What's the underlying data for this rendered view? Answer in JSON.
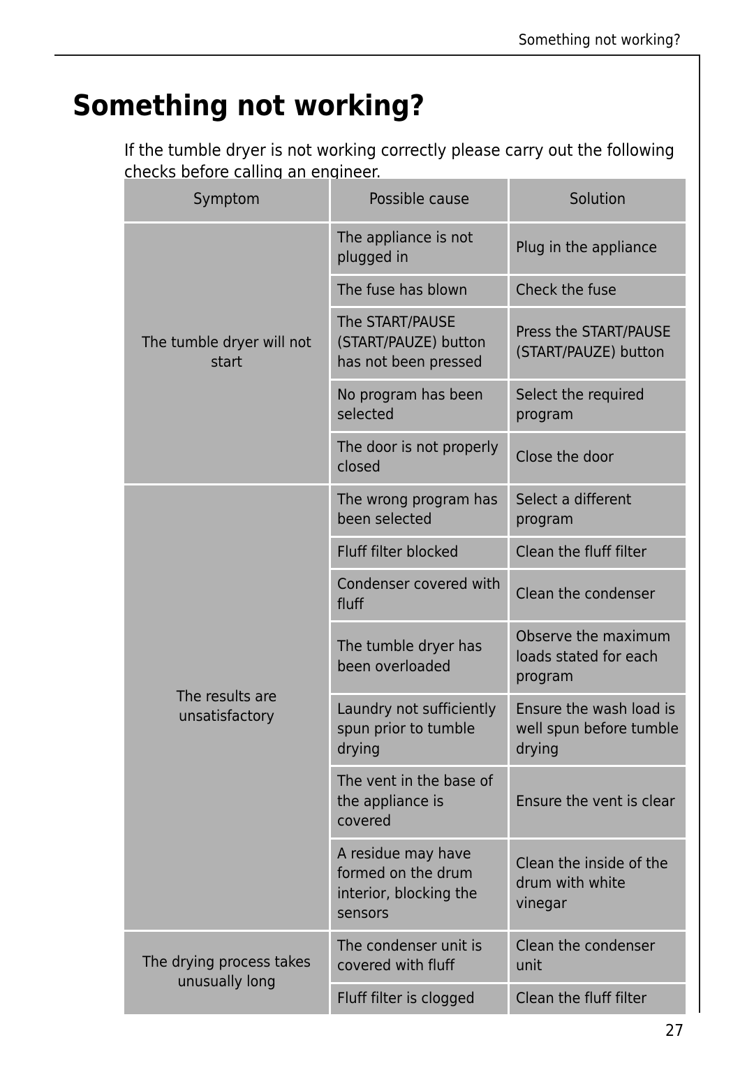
{
  "header": {
    "running_title": "Something not working?"
  },
  "title": "Something not working?",
  "intro": "If the tumble dryer is not working correctly please carry out the following checks before calling an engineer.",
  "table": {
    "columns": [
      "Symptom",
      "Possible cause",
      "Solution"
    ],
    "groups": [
      {
        "symptom": "The tumble dryer will not start",
        "rows": [
          {
            "cause": "The appliance is not plugged in",
            "solution": "Plug in the appliance"
          },
          {
            "cause": "The fuse has blown",
            "solution": "Check the fuse"
          },
          {
            "cause": "The START/PAUSE (START/PAUZE) button has not been pressed",
            "solution": "Press the START/PAUSE (START/PAUZE) button"
          },
          {
            "cause": "No program has been selected",
            "solution": "Select the required program"
          },
          {
            "cause": "The door is not properly closed",
            "solution": "Close the door"
          }
        ]
      },
      {
        "symptom": "The results are unsatisfactory",
        "rows": [
          {
            "cause": "The wrong program has been selected",
            "solution": "Select a different program"
          },
          {
            "cause": "Fluff filter blocked",
            "solution": "Clean the fluff filter"
          },
          {
            "cause": "Condenser covered with fluff",
            "solution": "Clean the condenser"
          },
          {
            "cause": "The tumble dryer has been overloaded",
            "solution": "Observe the maximum loads stated for each program"
          },
          {
            "cause": "Laundry not sufficiently spun prior to tumble drying",
            "solution": "Ensure the wash load is well spun before tumble drying"
          },
          {
            "cause": "The vent in the base of the appliance is covered",
            "solution": "Ensure the vent is clear"
          },
          {
            "cause": "A residue may have formed on the drum interior, blocking the sensors",
            "solution": "Clean the inside of the drum with white vinegar"
          }
        ]
      },
      {
        "symptom": "The drying process takes unusually long",
        "rows": [
          {
            "cause": "The condenser unit is covered with fluff",
            "solution": "Clean the condenser unit"
          },
          {
            "cause": "Fluff filter is clogged",
            "solution": "Clean the fluff filter"
          }
        ]
      }
    ]
  },
  "page_number": "27",
  "colors": {
    "cell_background": "#b2b2b2",
    "rule": "#1a1a1a",
    "text": "#000000",
    "page_background": "#ffffff"
  }
}
